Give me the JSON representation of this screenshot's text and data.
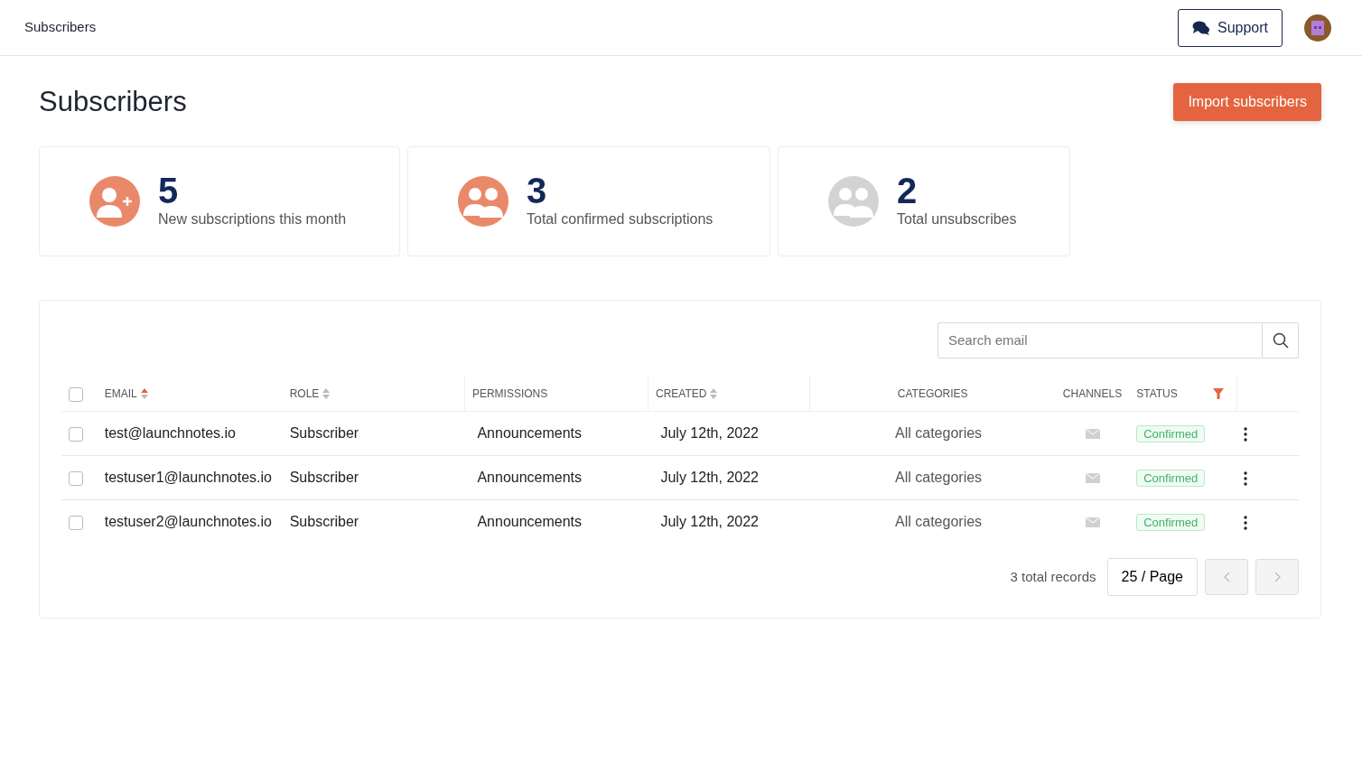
{
  "topbar": {
    "title": "Subscribers",
    "support_button": "Support"
  },
  "page": {
    "title": "Subscribers",
    "import_button": "Import subscribers"
  },
  "stats": [
    {
      "kind": "add",
      "value": "5",
      "label": "New subscriptions this month"
    },
    {
      "kind": "group",
      "value": "3",
      "label": "Total confirmed subscriptions"
    },
    {
      "kind": "group-muted",
      "value": "2",
      "label": "Total unsubscribes"
    }
  ],
  "search": {
    "placeholder": "Search email"
  },
  "table": {
    "select_all": {
      "checked": false
    },
    "columns": [
      {
        "label": "EMAIL",
        "sorted": true
      },
      {
        "label": "ROLE",
        "sorted": false
      },
      {
        "label": "PERMISSIONS"
      },
      {
        "label": "CREATED",
        "sorted": false
      },
      {
        "label": "CATEGORIES"
      },
      {
        "label": "CHANNELS"
      },
      {
        "label": "STATUS",
        "filter_active": true
      }
    ],
    "rows": [
      {
        "checked": false,
        "email": "test@launchnotes.io",
        "role": "Subscriber",
        "permissions": "Announcements",
        "created": "July 12th, 2022",
        "categories": "All categories",
        "status": "Confirmed"
      },
      {
        "checked": false,
        "email": "testuser1@launchnotes.io",
        "role": "Subscriber",
        "permissions": "Announcements",
        "created": "July 12th, 2022",
        "categories": "All categories",
        "status": "Confirmed"
      },
      {
        "checked": false,
        "email": "testuser2@launchnotes.io",
        "role": "Subscriber",
        "permissions": "Announcements",
        "created": "July 12th, 2022",
        "categories": "All categories",
        "status": "Confirmed"
      }
    ]
  },
  "pagination": {
    "total": "3 total records",
    "page_size": "25 / Page",
    "prev": {
      "disabled": true
    },
    "next": {
      "disabled": true
    }
  }
}
